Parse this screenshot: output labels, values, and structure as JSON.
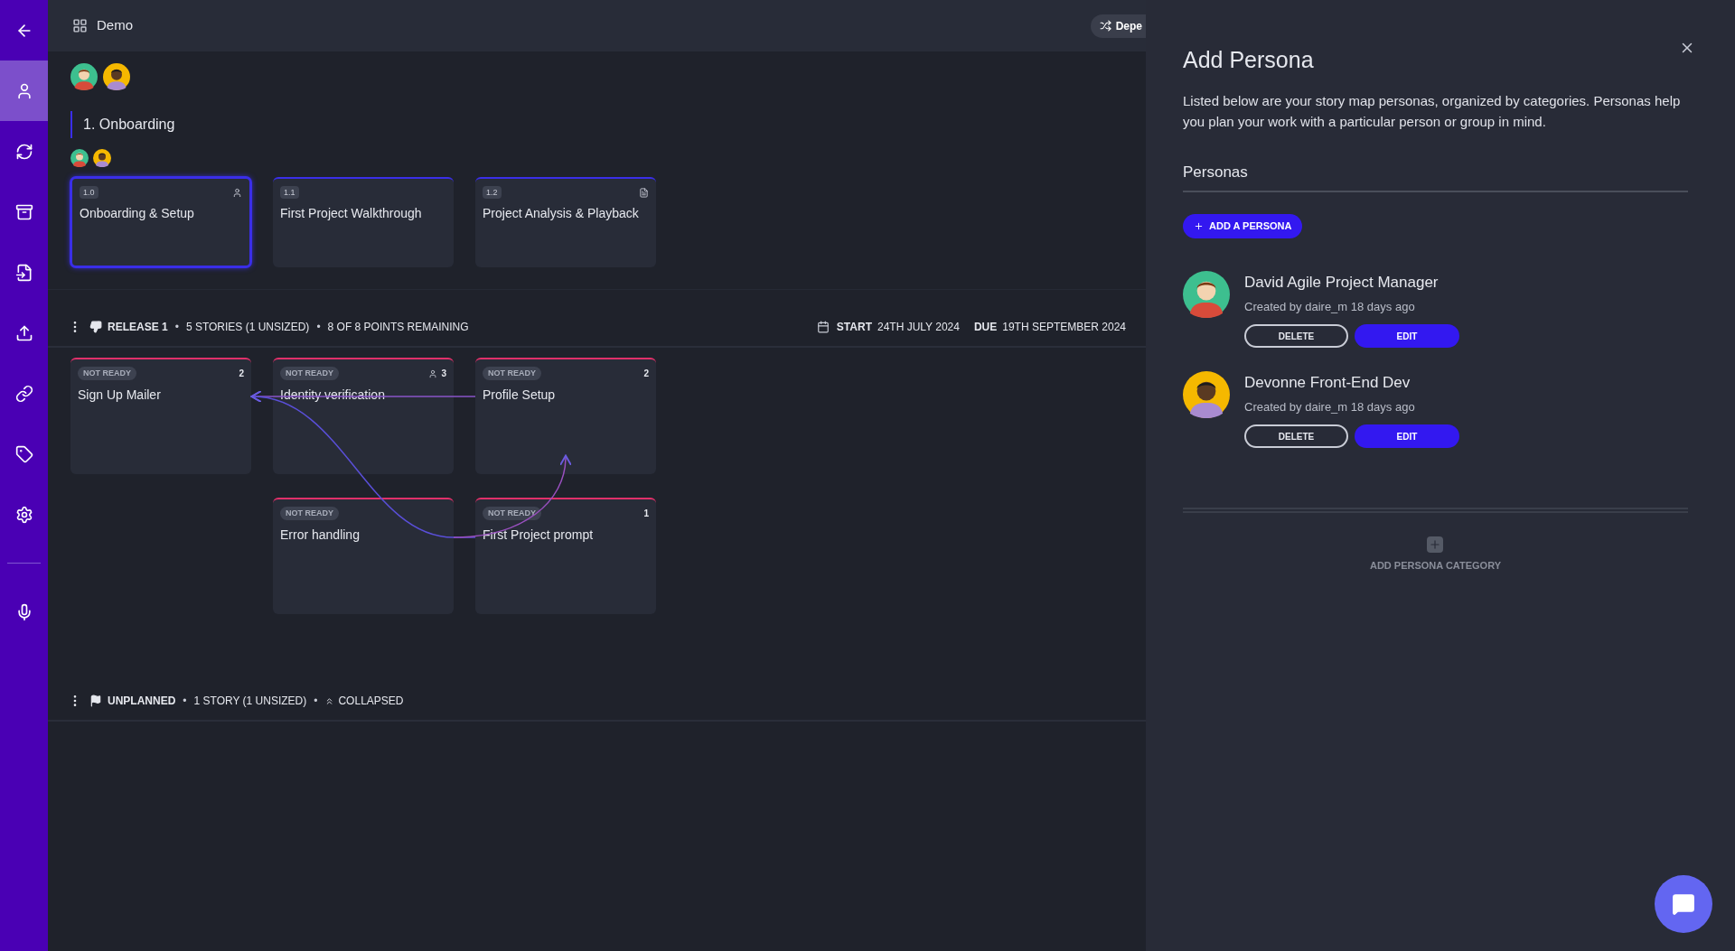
{
  "nav": [
    {
      "selected": false
    },
    {
      "selected": true
    },
    {
      "selected": false
    },
    {
      "selected": false
    },
    {
      "selected": false
    },
    {
      "selected": false
    },
    {
      "selected": false
    },
    {
      "selected": false
    },
    {
      "selected": false
    },
    {
      "selected": false
    }
  ],
  "header": {
    "title": "Demo",
    "button": "Depe"
  },
  "epic": {
    "title": "1. Onboarding"
  },
  "features": [
    {
      "number": "1.0",
      "title": "Onboarding & Setup",
      "selected": true
    },
    {
      "number": "1.1",
      "title": "First Project Walkthrough",
      "selected": false
    },
    {
      "number": "1.2",
      "title": "Project Analysis & Playback",
      "selected": false
    }
  ],
  "release": {
    "name": "RELEASE 1",
    "separator": "•",
    "stories": "5 STORIES (1 UNSIZED)",
    "points": "8 OF 8 POINTS REMAINING",
    "start_label": "START",
    "start": "24TH JULY 2024",
    "due_label": "DUE",
    "due": "19TH SEPTEMBER 2024"
  },
  "story_rows": [
    [
      {
        "status": "NOT READY",
        "title": "Sign Up Mailer",
        "count": "2",
        "kind": "points"
      },
      {
        "status": "NOT READY",
        "title": "Identity verification",
        "count": "3",
        "kind": "persona"
      },
      {
        "status": "NOT READY",
        "title": "Profile Setup",
        "count": "2",
        "kind": "points"
      }
    ],
    [
      null,
      {
        "status": "NOT READY",
        "title": "Error handling"
      },
      {
        "status": "NOT READY",
        "title": "First Project prompt",
        "count": "1",
        "kind": "points"
      }
    ]
  ],
  "unplanned": {
    "name": "UNPLANNED",
    "separator": "•",
    "stories": "1 STORY (1 UNSIZED)",
    "state": "COLLAPSED"
  },
  "panel": {
    "title": "Add Persona",
    "description": "Listed below are your story map personas, organized by categories. Personas help you plan your work with a particular person or group in mind.",
    "section": "Personas",
    "add_button": "ADD A PERSONA",
    "personas": [
      {
        "name": "David Agile Project Manager",
        "meta": "Created by daire_m 18 days ago",
        "delete": "DELETE",
        "edit": "EDIT"
      },
      {
        "name": "Devonne Front-End Dev",
        "meta": "Created by daire_m 18 days ago",
        "delete": "DELETE",
        "edit": "EDIT"
      }
    ],
    "add_category": "ADD PERSONA CATEGORY"
  }
}
